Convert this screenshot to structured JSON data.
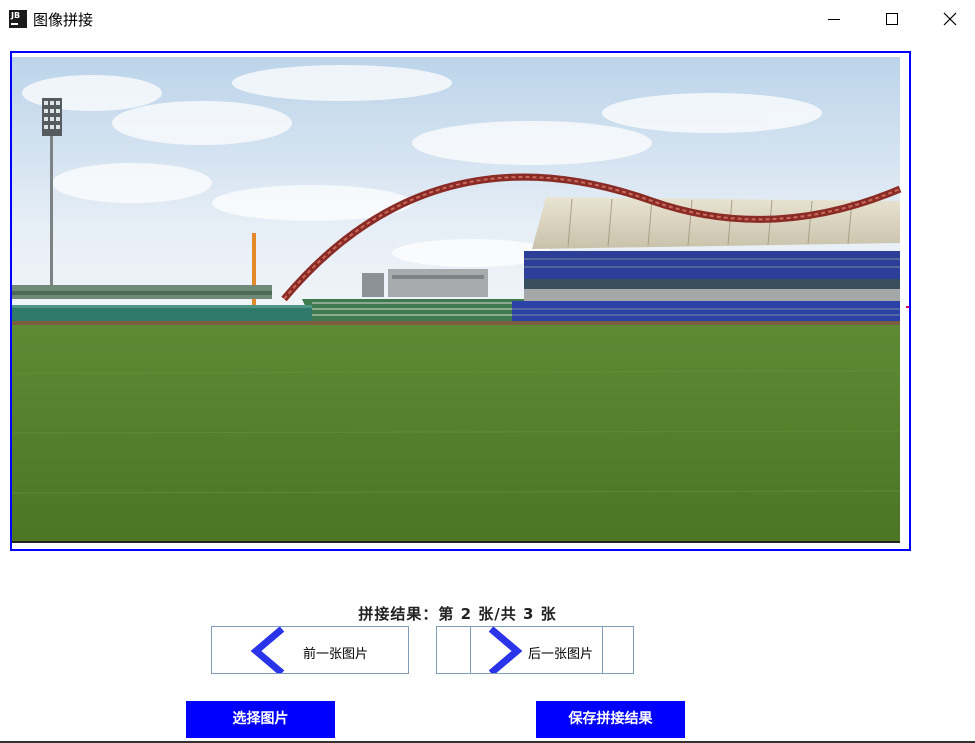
{
  "window": {
    "title": "图像拼接",
    "icon": "JB",
    "controls": [
      "minimize-icon",
      "maximize-icon",
      "close-icon"
    ]
  },
  "status": {
    "text": "拼接结果：第 2 张/共 3 张",
    "current": 2,
    "total": 3
  },
  "nav": {
    "prev_label": "前一张图片",
    "next_label": "后一张图片"
  },
  "actions": {
    "select_label": "选择图片",
    "save_label": "保存拼接结果"
  },
  "colors": {
    "frame_border": "#0000ff",
    "button_bg": "#0000ff",
    "button_text": "#ffffff",
    "arrow": "#2a34e8"
  }
}
